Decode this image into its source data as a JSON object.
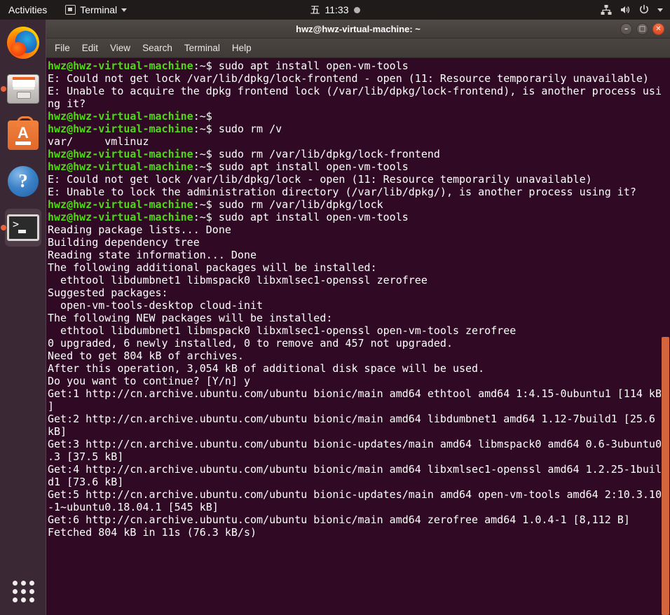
{
  "topbar": {
    "activities": "Activities",
    "app_icon": "terminal-app-icon",
    "app_name": "Terminal",
    "clock_day": "五",
    "clock_time": "11:33",
    "icons": [
      "network-wired-icon",
      "volume-icon",
      "power-icon",
      "chevron-down-icon"
    ]
  },
  "dock": {
    "items": [
      {
        "name": "firefox",
        "label": "Firefox Web Browser",
        "running": false,
        "active": false
      },
      {
        "name": "files",
        "label": "Files",
        "running": true,
        "active": false
      },
      {
        "name": "ubuntu-software",
        "label": "Ubuntu Software",
        "running": false,
        "active": false
      },
      {
        "name": "help",
        "label": "Help",
        "running": false,
        "active": false
      },
      {
        "name": "terminal",
        "label": "Terminal",
        "running": true,
        "active": true
      }
    ],
    "show_applications": "Show Applications"
  },
  "window": {
    "title": "hwz@hwz-virtual-machine: ~",
    "controls": {
      "minimize": "–",
      "maximize": "□",
      "close": "✕"
    },
    "menu": [
      "File",
      "Edit",
      "View",
      "Search",
      "Terminal",
      "Help"
    ]
  },
  "colors": {
    "terminal_bg": "#300a24",
    "prompt_green": "#4fd916",
    "text_white": "#ffffff",
    "scrollbar_thumb": "#d4643c",
    "close_button": "#dc4a21",
    "topbar_bg": "#1f1b1a",
    "dock_bg": "#3b2a35"
  },
  "terminal": {
    "prompt": "hwz@hwz-virtual-machine",
    "prompt_tail": ":~$",
    "lines": [
      {
        "t": "prompt",
        "cmd": " sudo apt install open-vm-tools"
      },
      {
        "t": "out",
        "text": "E: Could not get lock /var/lib/dpkg/lock-frontend - open (11: Resource temporarily unavailable)"
      },
      {
        "t": "out",
        "text": "E: Unable to acquire the dpkg frontend lock (/var/lib/dpkg/lock-frontend), is another process usi"
      },
      {
        "t": "out",
        "text": "ng it?"
      },
      {
        "t": "prompt",
        "cmd": ""
      },
      {
        "t": "prompt",
        "cmd": " sudo rm /v"
      },
      {
        "t": "out",
        "text": "var/     vmlinuz"
      },
      {
        "t": "prompt",
        "cmd": " sudo rm /var/lib/dpkg/lock-frontend"
      },
      {
        "t": "prompt",
        "cmd": " sudo apt install open-vm-tools"
      },
      {
        "t": "out",
        "text": "E: Could not get lock /var/lib/dpkg/lock - open (11: Resource temporarily unavailable)"
      },
      {
        "t": "out",
        "text": "E: Unable to lock the administration directory (/var/lib/dpkg/), is another process using it?"
      },
      {
        "t": "prompt",
        "cmd": " sudo rm /var/lib/dpkg/lock"
      },
      {
        "t": "prompt",
        "cmd": " sudo apt install open-vm-tools"
      },
      {
        "t": "out",
        "text": "Reading package lists... Done"
      },
      {
        "t": "out",
        "text": "Building dependency tree"
      },
      {
        "t": "out",
        "text": "Reading state information... Done"
      },
      {
        "t": "out",
        "text": "The following additional packages will be installed:"
      },
      {
        "t": "out",
        "text": "  ethtool libdumbnet1 libmspack0 libxmlsec1-openssl zerofree"
      },
      {
        "t": "out",
        "text": "Suggested packages:"
      },
      {
        "t": "out",
        "text": "  open-vm-tools-desktop cloud-init"
      },
      {
        "t": "out",
        "text": "The following NEW packages will be installed:"
      },
      {
        "t": "out",
        "text": "  ethtool libdumbnet1 libmspack0 libxmlsec1-openssl open-vm-tools zerofree"
      },
      {
        "t": "out",
        "text": "0 upgraded, 6 newly installed, 0 to remove and 457 not upgraded."
      },
      {
        "t": "out",
        "text": "Need to get 804 kB of archives."
      },
      {
        "t": "out",
        "text": "After this operation, 3,054 kB of additional disk space will be used."
      },
      {
        "t": "out",
        "text": "Do you want to continue? [Y/n] y"
      },
      {
        "t": "out",
        "text": "Get:1 http://cn.archive.ubuntu.com/ubuntu bionic/main amd64 ethtool amd64 1:4.15-0ubuntu1 [114 kB"
      },
      {
        "t": "out",
        "text": "]"
      },
      {
        "t": "out",
        "text": "Get:2 http://cn.archive.ubuntu.com/ubuntu bionic/main amd64 libdumbnet1 amd64 1.12-7build1 [25.6"
      },
      {
        "t": "out",
        "text": "kB]"
      },
      {
        "t": "out",
        "text": "Get:3 http://cn.archive.ubuntu.com/ubuntu bionic-updates/main amd64 libmspack0 amd64 0.6-3ubuntu0"
      },
      {
        "t": "out",
        "text": ".3 [37.5 kB]"
      },
      {
        "t": "out",
        "text": "Get:4 http://cn.archive.ubuntu.com/ubuntu bionic/main amd64 libxmlsec1-openssl amd64 1.2.25-1buil"
      },
      {
        "t": "out",
        "text": "d1 [73.6 kB]"
      },
      {
        "t": "out",
        "text": "Get:5 http://cn.archive.ubuntu.com/ubuntu bionic-updates/main amd64 open-vm-tools amd64 2:10.3.10"
      },
      {
        "t": "out",
        "text": "-1~ubuntu0.18.04.1 [545 kB]"
      },
      {
        "t": "out",
        "text": "Get:6 http://cn.archive.ubuntu.com/ubuntu bionic/main amd64 zerofree amd64 1.0.4-1 [8,112 B]"
      },
      {
        "t": "out",
        "text": "Fetched 804 kB in 11s (76.3 kB/s)"
      }
    ]
  }
}
